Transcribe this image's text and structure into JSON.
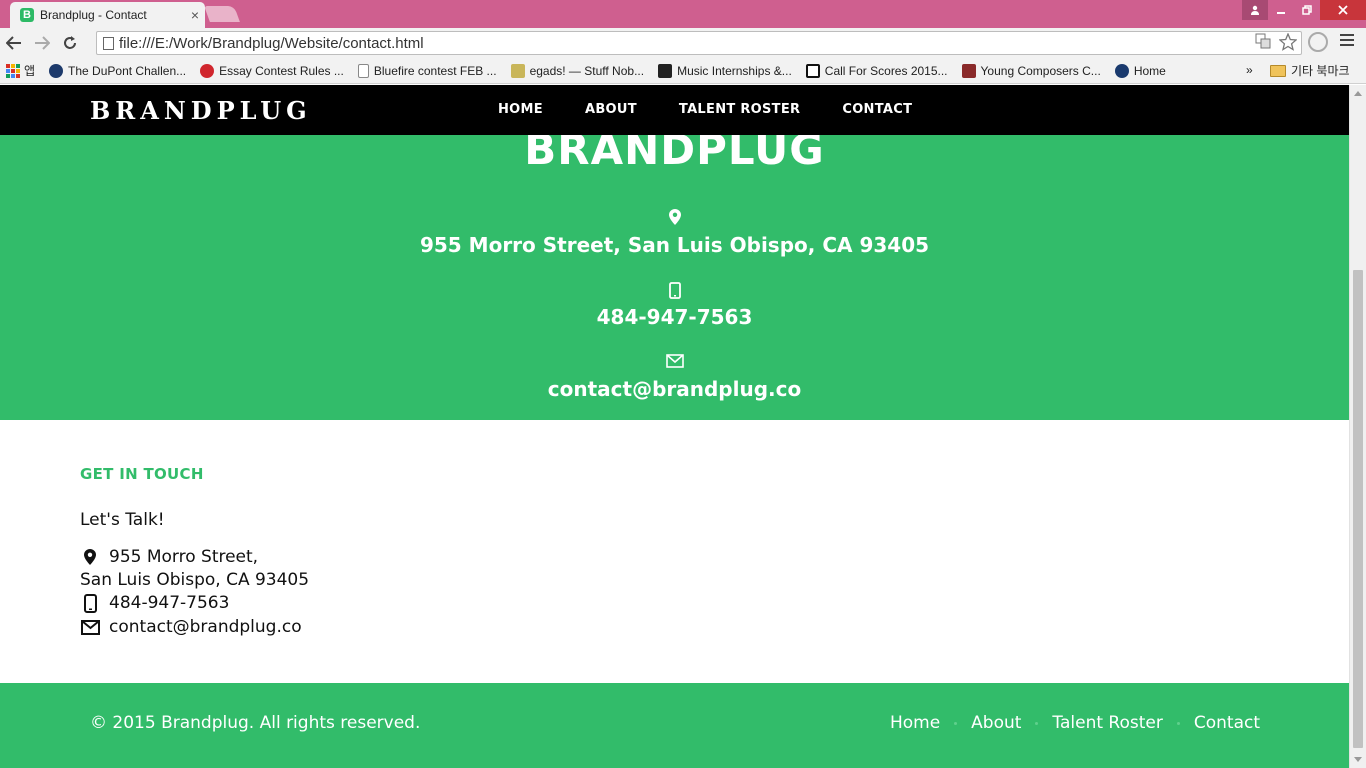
{
  "browser": {
    "tab_title": "Brandplug - Contact",
    "tab_favicon": "B",
    "tab_close": "×",
    "address": "file:///E:/Work/Brandplug/Website/contact.html",
    "bookmarks": [
      {
        "label": "앱",
        "icon": "apps-icon"
      },
      {
        "label": "The DuPont Challen...",
        "icon": "star-badge-icon",
        "color": "#1d3a6b"
      },
      {
        "label": "Essay Contest Rules ...",
        "icon": "red-flower-icon",
        "color": "#d0262d"
      },
      {
        "label": "Bluefire contest FEB ...",
        "icon": "page-icon",
        "color": "#ffffff"
      },
      {
        "label": "egads! — Stuff Nob...",
        "icon": "smiley-icon",
        "color": "#c9b65a"
      },
      {
        "label": "Music Internships &...",
        "icon": "music-icon",
        "color": "#222222"
      },
      {
        "label": "Call For Scores 2015...",
        "icon": "score-icon",
        "color": "#111111"
      },
      {
        "label": "Young Composers C...",
        "icon": "composer-icon",
        "color": "#8a2a2a"
      },
      {
        "label": "Home",
        "icon": "kiwanis-icon",
        "color": "#1a3a6e"
      }
    ],
    "bookmarks_more": "»",
    "other_bookmarks": "기타 북마크"
  },
  "site": {
    "brand": "BRANDPLUG",
    "nav": [
      "HOME",
      "ABOUT",
      "TALENT ROSTER",
      "CONTACT"
    ],
    "hero": {
      "title": "BRANDPLUG",
      "address": "955 Morro Street, San Luis Obispo, CA 93405",
      "phone": "484-947-7563",
      "email": "contact@brandplug.co"
    },
    "contact": {
      "heading": "GET IN TOUCH",
      "subheading": "Let's Talk!",
      "address_line1": "955 Morro Street,",
      "address_line2": "San Luis Obispo, CA 93405",
      "phone": "484-947-7563",
      "email": "contact@brandplug.co"
    },
    "footer": {
      "copyright": "© 2015 Brandplug. All rights reserved.",
      "links": [
        "Home",
        "About",
        "Talent Roster",
        "Contact"
      ]
    }
  },
  "colors": {
    "accent_green": "#32bc6a",
    "nav_black": "#000000",
    "chrome_pink": "#cf5f8f"
  }
}
